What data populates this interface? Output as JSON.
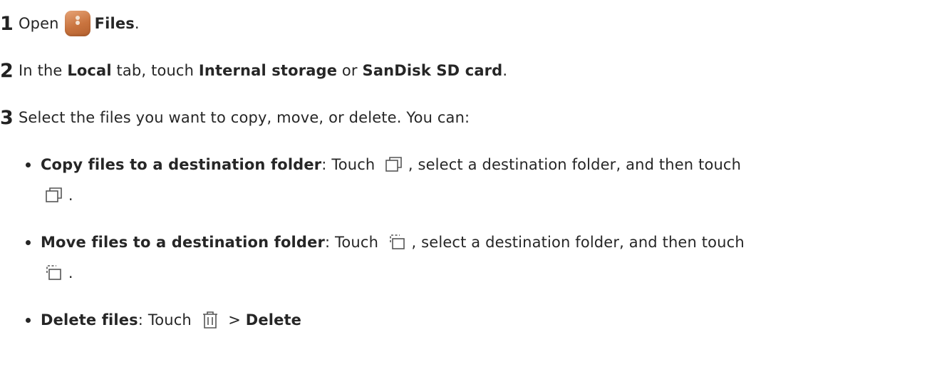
{
  "step1": {
    "number": "1",
    "text_before": "Open",
    "app_icon": "files-app-icon",
    "app_name": "Files",
    "text_after": "."
  },
  "step2": {
    "number": "2",
    "t1": "In the",
    "b1": "Local",
    "t2": "tab, touch",
    "b2": "Internal storage",
    "t3": "or",
    "b3": "SanDisk SD card",
    "t4": "."
  },
  "step3": {
    "number": "3",
    "text": "Select the files you want to copy, move, or delete. You can:"
  },
  "copy": {
    "bold": "Copy files to a destination folder",
    "t1": ": Touch",
    "icon": "copy-icon",
    "t2": ", select a destination folder, and then touch",
    "t3": "."
  },
  "move": {
    "bold": "Move files to a destination folder",
    "t1": ": Touch",
    "icon": "move-icon",
    "t2": ", select a destination folder, and then touch",
    "t3": "."
  },
  "delete": {
    "bold": "Delete files",
    "t1": ": Touch",
    "icon": "trash-icon",
    "sep": ">",
    "bold2": "Delete"
  },
  "colors": {
    "text": "#262626",
    "icon_stroke": "#555555",
    "app_icon": "#c9743f"
  }
}
